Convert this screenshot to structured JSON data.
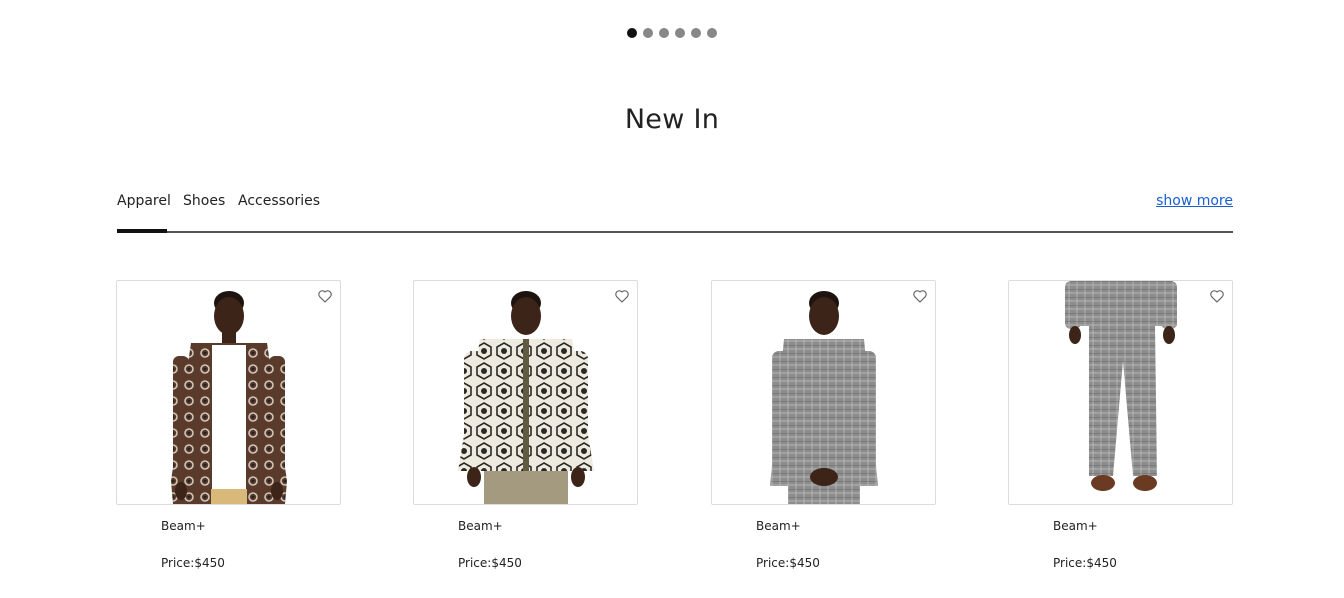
{
  "carousel": {
    "dot_count": 6,
    "active_index": 0
  },
  "section": {
    "title": "New In"
  },
  "tabs": [
    {
      "label": "Apparel",
      "active": true
    },
    {
      "label": "Shoes",
      "active": false
    },
    {
      "label": "Accessories",
      "active": false
    }
  ],
  "show_more_label": "show more",
  "products": [
    {
      "brand": "Beam+",
      "price_label": "Price:",
      "price": "$450",
      "image": "brown-patterned-cardigan"
    },
    {
      "brand": "Beam+",
      "price_label": "Price:",
      "price": "$450",
      "image": "cream-floral-zip-jacket"
    },
    {
      "brand": "Beam+",
      "price_label": "Price:",
      "price": "$450",
      "image": "grey-check-overshirt"
    },
    {
      "brand": "Beam+",
      "price_label": "Price:",
      "price": "$450",
      "image": "grey-check-trousers"
    }
  ],
  "colors": {
    "link": "#1a5fd1",
    "active_dot": "#111111",
    "inactive_dot": "#888888"
  }
}
